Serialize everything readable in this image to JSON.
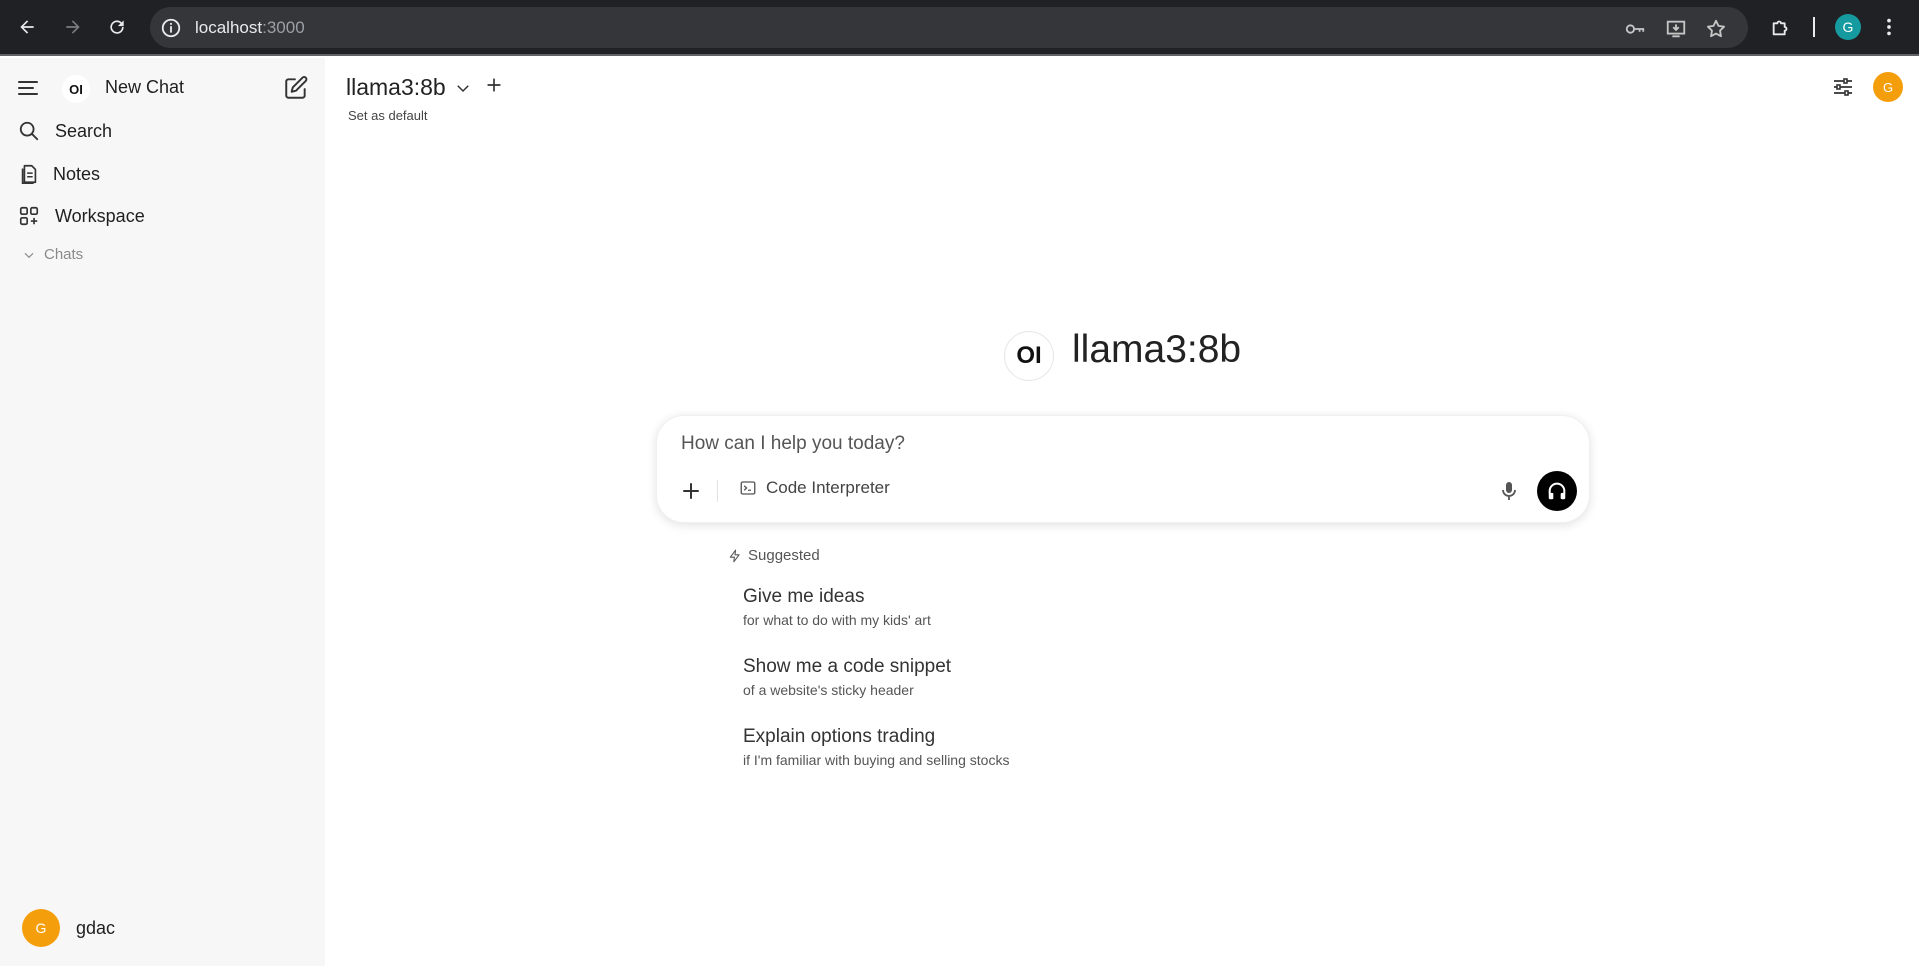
{
  "browser": {
    "url_host": "localhost",
    "url_port": ":3000",
    "profile_initial": "G"
  },
  "sidebar": {
    "new_chat": "New Chat",
    "logo_text": "OI",
    "items": [
      {
        "label": "Search",
        "icon": "search-icon"
      },
      {
        "label": "Notes",
        "icon": "notes-icon"
      },
      {
        "label": "Workspace",
        "icon": "workspace-icon"
      }
    ],
    "chats_label": "Chats",
    "user": {
      "initial": "G",
      "name": "gdac"
    }
  },
  "header": {
    "model": "llama3:8b",
    "set_default": "Set as default",
    "avatar_initial": "G"
  },
  "main": {
    "logo_text": "OI",
    "model_title": "llama3:8b",
    "composer": {
      "placeholder": "How can I help you today?",
      "tool": "Code Interpreter"
    },
    "suggested_label": "Suggested",
    "suggestions": [
      {
        "title": "Give me ideas",
        "subtitle": "for what to do with my kids' art"
      },
      {
        "title": "Show me a code snippet",
        "subtitle": "of a website's sticky header"
      },
      {
        "title": "Explain options trading",
        "subtitle": "if I'm familiar with buying and selling stocks"
      }
    ]
  },
  "colors": {
    "chrome_bg": "#202124",
    "sidebar_bg": "#f7f7f7",
    "avatar": "#f59e0b",
    "profile": "#159aa0"
  }
}
